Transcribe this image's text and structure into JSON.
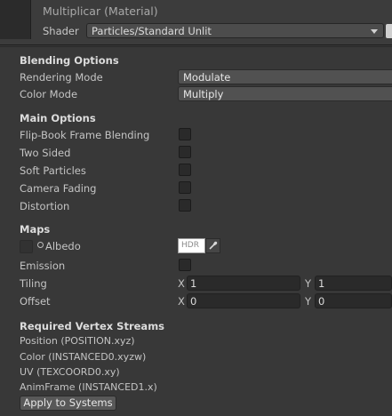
{
  "header": {
    "title": "Multiplicar (Material)",
    "shader_label": "Shader",
    "shader_value": "Particles/Standard Unlit"
  },
  "blending": {
    "title": "Blending Options",
    "rendering_mode_label": "Rendering Mode",
    "rendering_mode_value": "Modulate",
    "color_mode_label": "Color Mode",
    "color_mode_value": "Multiply"
  },
  "main_options": {
    "title": "Main Options",
    "items": [
      {
        "label": "Flip-Book Frame Blending",
        "checked": false
      },
      {
        "label": "Two Sided",
        "checked": false
      },
      {
        "label": "Soft Particles",
        "checked": false
      },
      {
        "label": "Camera Fading",
        "checked": false
      },
      {
        "label": "Distortion",
        "checked": false
      }
    ]
  },
  "maps": {
    "title": "Maps",
    "albedo_label": "Albedo",
    "hdr_text": "HDR",
    "emission_label": "Emission",
    "tiling_label": "Tiling",
    "tiling_x": "1",
    "tiling_y": "1",
    "offset_label": "Offset",
    "offset_x": "0",
    "offset_y": "0",
    "x_axis": "X",
    "y_axis": "Y"
  },
  "vertex_streams": {
    "title": "Required Vertex Streams",
    "items": [
      "Position (POSITION.xyz)",
      "Color (INSTANCED0.xyzw)",
      "UV (TEXCOORD0.xy)",
      "AnimFrame (INSTANCED1.x)"
    ],
    "apply_label": "Apply to Systems"
  },
  "icons": {
    "shader_dropdown": "chevron-down-icon",
    "albedo": "circle-dot-icon",
    "picker": "eyedropper-icon"
  }
}
